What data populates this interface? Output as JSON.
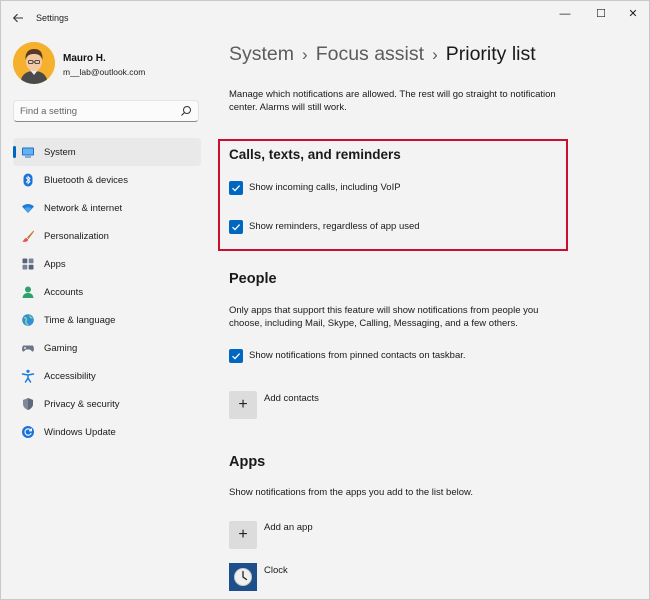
{
  "window": {
    "title": "Settings",
    "back_icon": "back-arrow-icon",
    "controls": {
      "minimize": "—",
      "maximize": "☐",
      "close": "✕"
    }
  },
  "profile": {
    "name": "Mauro H.",
    "email": "m__lab@outlook.com"
  },
  "search": {
    "placeholder": "Find a setting",
    "icon": "search-icon"
  },
  "sidebar": {
    "items": [
      {
        "label": "System",
        "icon": "system-icon",
        "active": true
      },
      {
        "label": "Bluetooth & devices",
        "icon": "bluetooth-icon"
      },
      {
        "label": "Network & internet",
        "icon": "wifi-icon"
      },
      {
        "label": "Personalization",
        "icon": "brush-icon"
      },
      {
        "label": "Apps",
        "icon": "apps-icon"
      },
      {
        "label": "Accounts",
        "icon": "accounts-icon"
      },
      {
        "label": "Time & language",
        "icon": "globe-icon"
      },
      {
        "label": "Gaming",
        "icon": "gaming-icon"
      },
      {
        "label": "Accessibility",
        "icon": "accessibility-icon"
      },
      {
        "label": "Privacy & security",
        "icon": "shield-icon"
      },
      {
        "label": "Windows Update",
        "icon": "update-icon"
      }
    ]
  },
  "breadcrumb": {
    "items": [
      "System",
      "Focus assist",
      "Priority list"
    ],
    "separator": "›"
  },
  "main": {
    "intro": "Manage which notifications are allowed. The rest will go straight to notification center. Alarms will still work.",
    "calls": {
      "title": "Calls, texts, and reminders",
      "option1": "Show incoming calls, including VoIP",
      "option2": "Show reminders, regardless of app used"
    },
    "people": {
      "title": "People",
      "description": "Only apps that support this feature will show notifications from people you choose, including Mail, Skype, Calling, Messaging, and a few others.",
      "option1": "Show notifications from pinned contacts on taskbar.",
      "add_label": "Add contacts",
      "add_symbol": "+"
    },
    "apps": {
      "title": "Apps",
      "description": "Show notifications from the apps you add to the list below.",
      "add_label": "Add an app",
      "add_symbol": "+",
      "list": [
        {
          "name": "Clock",
          "icon": "clock-icon"
        }
      ]
    }
  },
  "colors": {
    "accent": "#0067c0",
    "highlight_border": "#c8102e",
    "background": "#f3f3f3"
  }
}
